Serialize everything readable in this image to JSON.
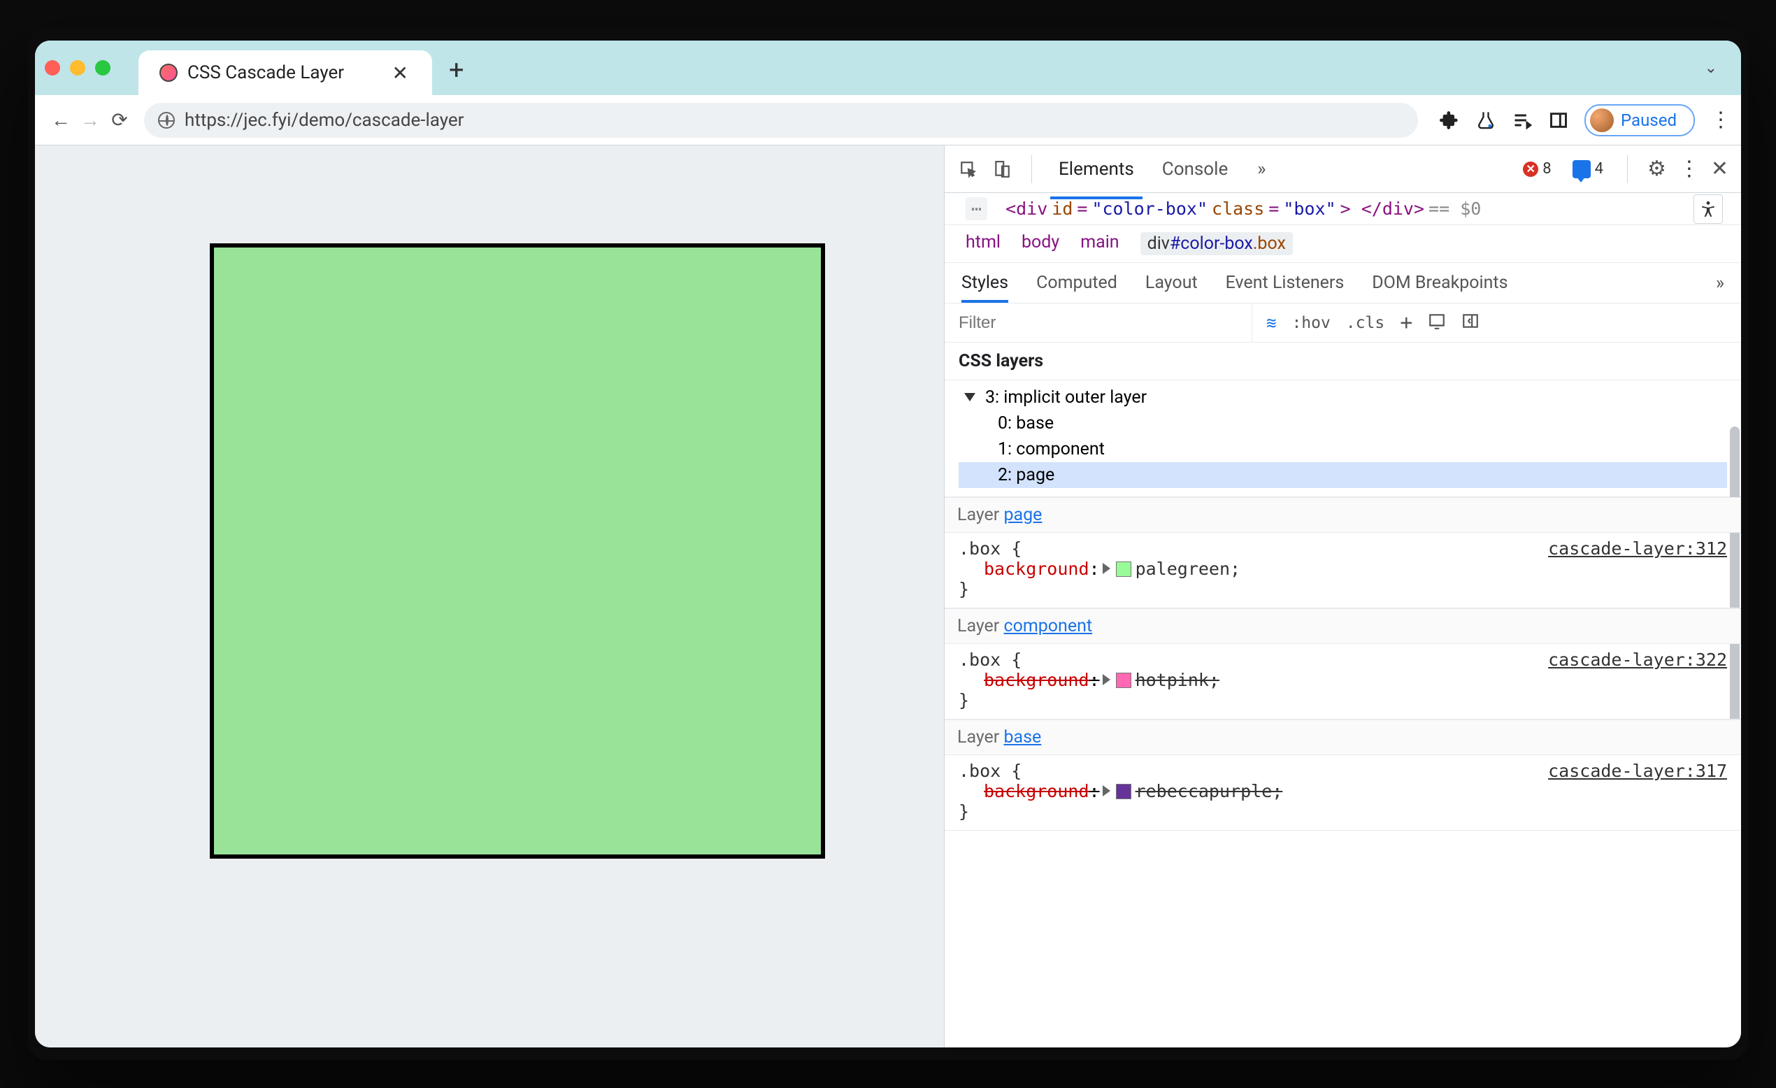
{
  "tab": {
    "title": "CSS Cascade Layer"
  },
  "url": "https://jec.fyi/demo/cascade-layer",
  "paused": "Paused",
  "devtools": {
    "tabs": {
      "elements": "Elements",
      "console": "Console"
    },
    "errors": 8,
    "messages": 4,
    "domline": {
      "open": "<div",
      "idattr": "id",
      "idval": "\"color-box\"",
      "classattr": "class",
      "classval": "\"box\"",
      "close": "> </div>",
      "eq": "== $0"
    },
    "crumb": {
      "html": "html",
      "body": "body",
      "main": "main",
      "selected": "div#color-box.box"
    },
    "subtabs": {
      "styles": "Styles",
      "computed": "Computed",
      "layout": "Layout",
      "events": "Event Listeners",
      "dombp": "DOM Breakpoints"
    },
    "filter_placeholder": "Filter",
    "hov": ":hov",
    "cls": ".cls",
    "layers_title": "CSS layers",
    "tree": {
      "root": "3: implicit outer layer",
      "i0": "0: base",
      "i1": "1: component",
      "i2": "2: page"
    },
    "rules": [
      {
        "layer_label": "Layer ",
        "layer_link": "page",
        "selector": ".box {",
        "prop": "background",
        "value": "palegreen",
        "src": "cascade-layer:312",
        "swatch": "sw-palegreen",
        "strike": false
      },
      {
        "layer_label": "Layer ",
        "layer_link": "component",
        "selector": ".box {",
        "prop": "background",
        "value": "hotpink",
        "src": "cascade-layer:322",
        "swatch": "sw-hotpink",
        "strike": true
      },
      {
        "layer_label": "Layer ",
        "layer_link": "base",
        "selector": ".box {",
        "prop": "background",
        "value": "rebeccapurple",
        "src": "cascade-layer:317",
        "swatch": "sw-rebecca",
        "strike": true
      }
    ]
  }
}
